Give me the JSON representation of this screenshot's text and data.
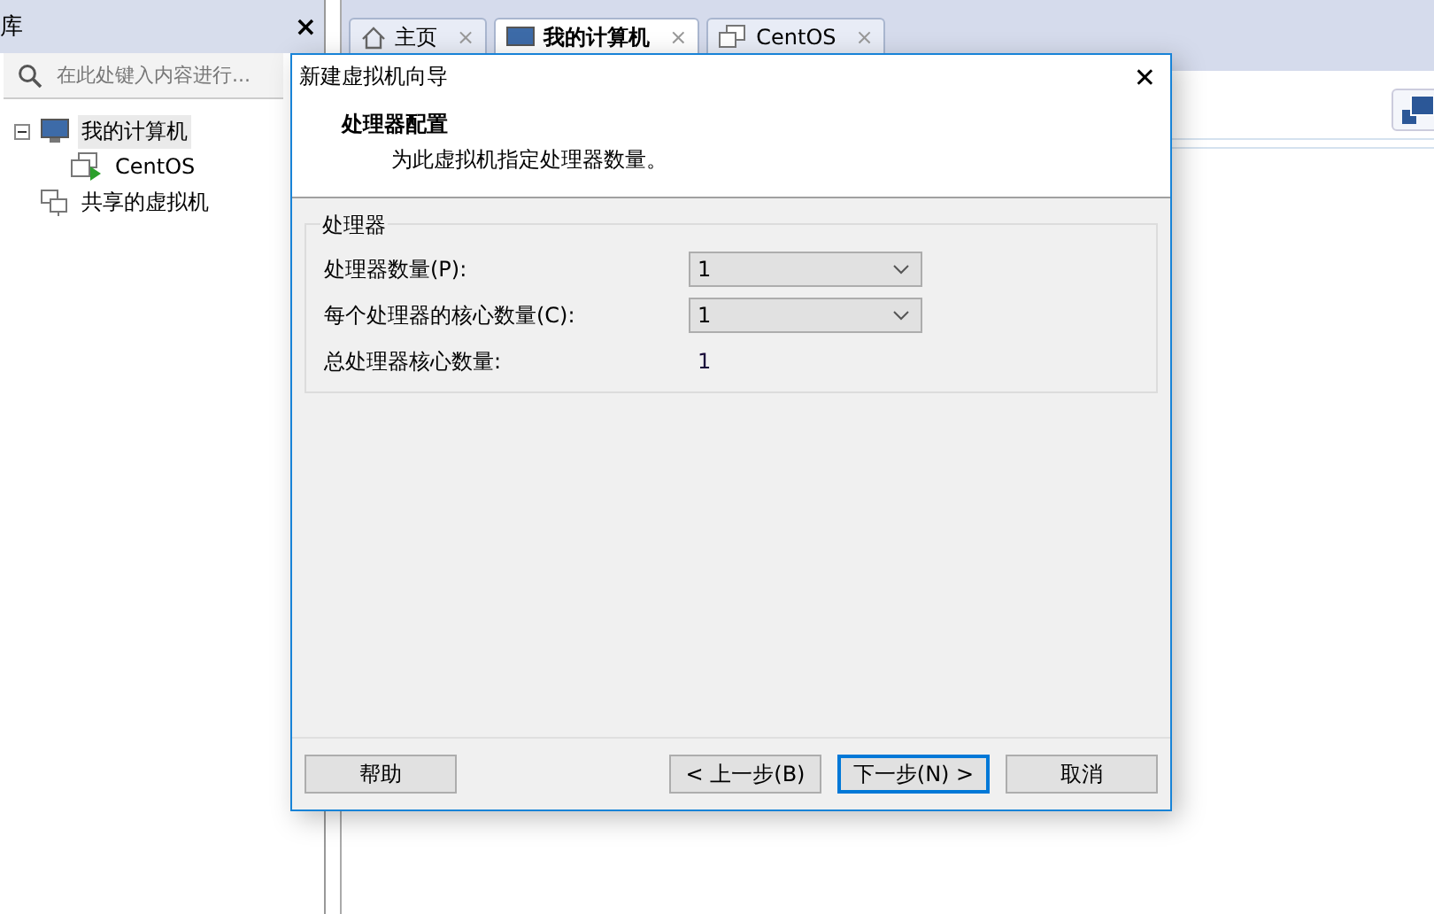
{
  "library": {
    "title": "库",
    "close": "×",
    "search": {
      "placeholder": "在此处键入内容进行..."
    },
    "tree": [
      {
        "label": "我的计算机",
        "kind": "monitor",
        "selected": true,
        "expanded": true,
        "children": [
          {
            "label": "CentOS",
            "kind": "vm",
            "selected": false
          }
        ]
      },
      {
        "label": "共享的虚拟机",
        "kind": "shared",
        "selected": false
      }
    ]
  },
  "tabs": [
    {
      "label": "主页",
      "kind": "home",
      "selected": false,
      "close": "×"
    },
    {
      "label": "我的计算机",
      "kind": "monitor",
      "selected": true,
      "close": "×"
    },
    {
      "label": "CentOS",
      "kind": "vm",
      "selected": false,
      "close": "×"
    }
  ],
  "dialog": {
    "title": "新建虚拟机向导",
    "close": "✕",
    "heading": "处理器配置",
    "subheading": "为此虚拟机指定处理器数量。",
    "group": {
      "title": "处理器",
      "rows": [
        {
          "kind": "select",
          "label": "处理器数量(P):",
          "value": "1"
        },
        {
          "kind": "select",
          "label": "每个处理器的核心数量(C):",
          "value": "1"
        },
        {
          "kind": "text",
          "label": "总处理器核心数量:",
          "value": "1"
        }
      ]
    },
    "buttons": [
      {
        "label": "帮助",
        "default": false
      },
      {
        "label": "< 上一步(B)",
        "default": false
      },
      {
        "label": "下一步(N) >",
        "default": true
      },
      {
        "label": "取消",
        "default": false
      }
    ]
  }
}
